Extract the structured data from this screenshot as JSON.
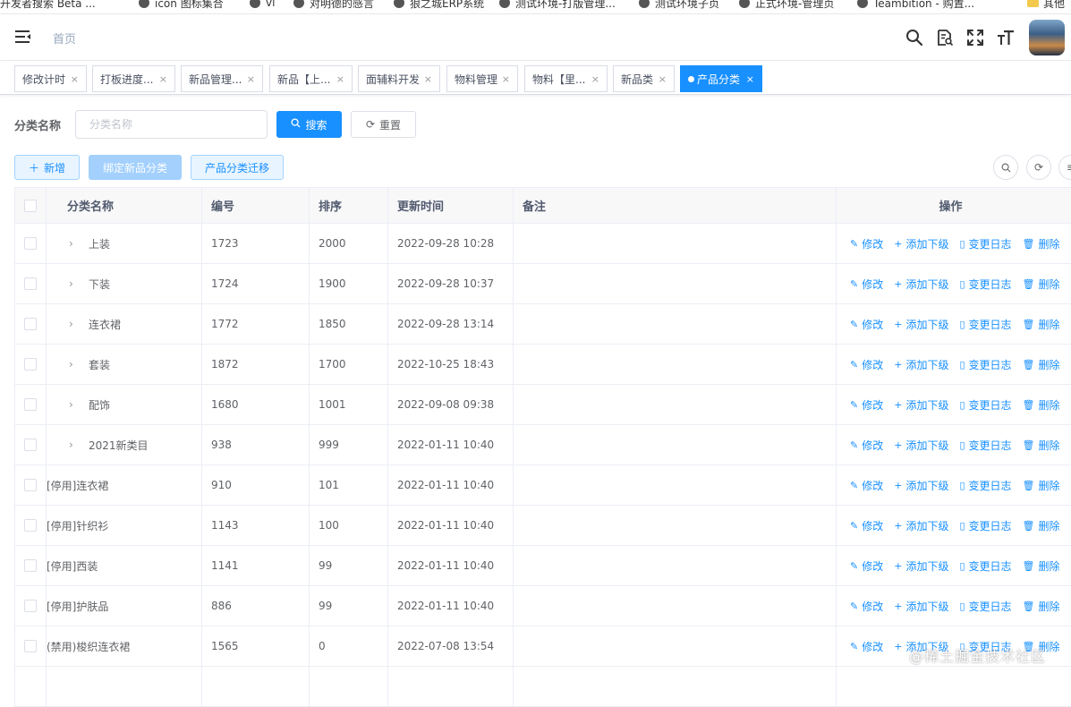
{
  "bookmarks": [
    {
      "label": "开发者搜索 Beta ...",
      "icon": "web-icon"
    },
    {
      "label": "icon 图标集合",
      "icon": "web-icon"
    },
    {
      "label": "vi",
      "icon": "web-icon"
    },
    {
      "label": "对明德的感言",
      "icon": "web-icon"
    },
    {
      "label": "狼之城ERP系统",
      "icon": "web-icon"
    },
    {
      "label": "测试环境-打版管理...",
      "icon": "web-icon"
    },
    {
      "label": "测试环境子页",
      "icon": "web-icon"
    },
    {
      "label": "正式环境-管理页",
      "icon": "web-icon"
    },
    {
      "label": "Teambition - 购置...",
      "icon": "web-icon"
    },
    {
      "label": "其他",
      "icon": "folder-icon"
    }
  ],
  "navbar": {
    "breadcrumb": "首页",
    "icons": [
      "search-icon",
      "document-search-icon",
      "fullscreen-icon",
      "font-size-icon"
    ]
  },
  "tags": [
    {
      "label": "修改计时",
      "active": false
    },
    {
      "label": "打板进度...",
      "active": false
    },
    {
      "label": "新品管理...",
      "active": false
    },
    {
      "label": "新品【上...",
      "active": false
    },
    {
      "label": "面辅料开发",
      "active": false
    },
    {
      "label": "物料管理",
      "active": false
    },
    {
      "label": "物料【里...",
      "active": false
    },
    {
      "label": "新品类",
      "active": false
    },
    {
      "label": "产品分类",
      "active": true
    }
  ],
  "search": {
    "label": "分类名称",
    "placeholder": "分类名称",
    "value": "",
    "search_button": "搜索",
    "reset_button": "重置"
  },
  "toolbar": {
    "add_button": "新增",
    "bind_button": "绑定新品分类",
    "migrate_button": "产品分类迁移"
  },
  "table": {
    "columns": [
      "分类名称",
      "编号",
      "排序",
      "更新时间",
      "备注",
      "操作"
    ],
    "actions": [
      "修改",
      "添加下级",
      "变更日志",
      "删除"
    ],
    "rows": [
      {
        "name": "上装",
        "code": "1723",
        "sort": "2000",
        "updated": "2022-09-28 10:28",
        "remark": "",
        "expandable": true
      },
      {
        "name": "下装",
        "code": "1724",
        "sort": "1900",
        "updated": "2022-09-28 10:37",
        "remark": "",
        "expandable": true
      },
      {
        "name": "连衣裙",
        "code": "1772",
        "sort": "1850",
        "updated": "2022-09-28 13:14",
        "remark": "",
        "expandable": true
      },
      {
        "name": "套装",
        "code": "1872",
        "sort": "1700",
        "updated": "2022-10-25 18:43",
        "remark": "",
        "expandable": true
      },
      {
        "name": "配饰",
        "code": "1680",
        "sort": "1001",
        "updated": "2022-09-08 09:38",
        "remark": "",
        "expandable": true
      },
      {
        "name": "2021新类目",
        "code": "938",
        "sort": "999",
        "updated": "2022-01-11 10:40",
        "remark": "",
        "expandable": true
      },
      {
        "name": "[停用]连衣裙",
        "code": "910",
        "sort": "101",
        "updated": "2022-01-11 10:40",
        "remark": "",
        "expandable": false
      },
      {
        "name": "[停用]针织衫",
        "code": "1143",
        "sort": "100",
        "updated": "2022-01-11 10:40",
        "remark": "",
        "expandable": false
      },
      {
        "name": "[停用]西装",
        "code": "1141",
        "sort": "99",
        "updated": "2022-01-11 10:40",
        "remark": "",
        "expandable": false
      },
      {
        "name": "[停用]护肤品",
        "code": "886",
        "sort": "99",
        "updated": "2022-01-11 10:40",
        "remark": "",
        "expandable": false
      },
      {
        "name": "(禁用)梭织连衣裙",
        "code": "1565",
        "sort": "0",
        "updated": "2022-07-08 13:54",
        "remark": "",
        "expandable": false
      }
    ]
  },
  "watermark": "@稀土掘金技术社区",
  "colors": {
    "primary": "#1890ff",
    "text": "#606266",
    "border": "#ebeef5"
  }
}
